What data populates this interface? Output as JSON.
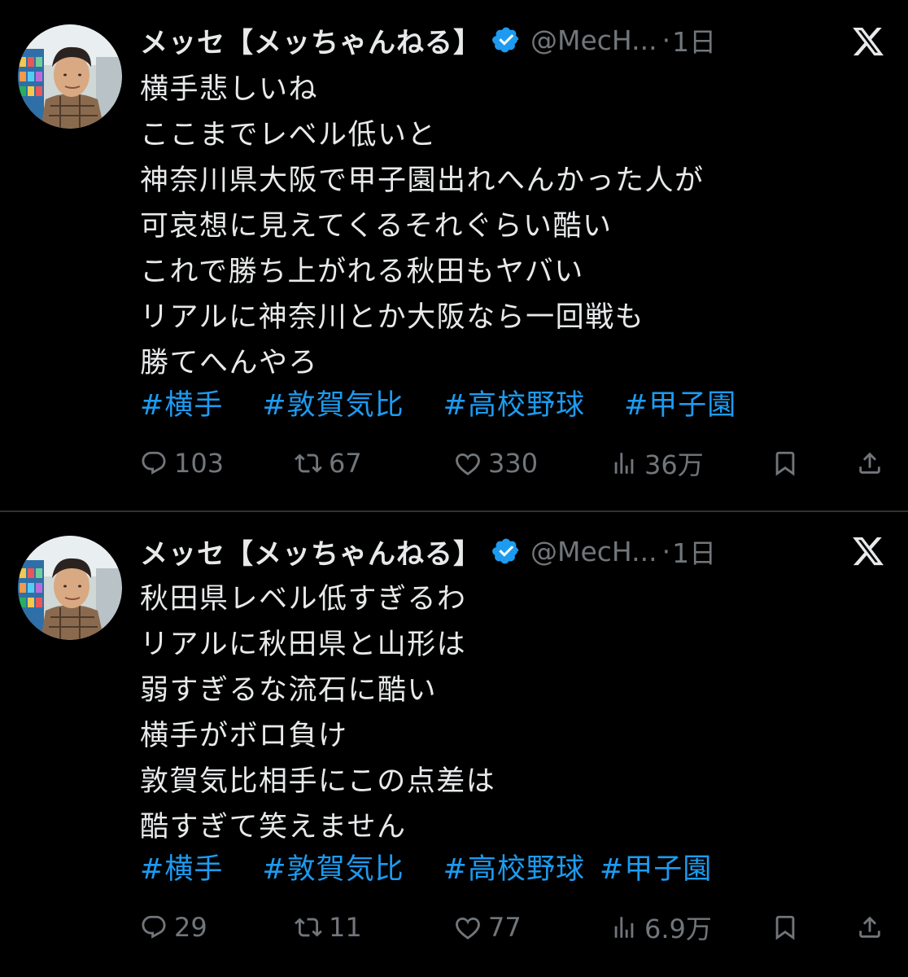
{
  "tweets": [
    {
      "display_name": "メッセ【メッちゃんねる】",
      "handle": "@MecH...",
      "separator": "·",
      "time": "1日",
      "lines": [
        "横手悲しいね",
        "ここまでレベル低いと",
        "神奈川県大阪で甲子園出れへんかった人が",
        "可哀想に見えてくるそれぐらい酷い",
        "これで勝ち上がれる秋田もヤバい",
        "リアルに神奈川とか大阪なら一回戦も",
        "勝てへんやろ"
      ],
      "hashtags": [
        "#横手",
        "#敦賀気比",
        "#高校野球",
        "#甲子園"
      ],
      "stats": {
        "replies": "103",
        "retweets": "67",
        "likes": "330",
        "views": "36万"
      }
    },
    {
      "display_name": "メッセ【メッちゃんねる】",
      "handle": "@MecH...",
      "separator": "·",
      "time": "1日",
      "lines": [
        "秋田県レベル低すぎるわ",
        "リアルに秋田県と山形は",
        "弱すぎるな流石に酷い",
        "横手がボロ負け",
        "敦賀気比相手にこの点差は",
        "酷すぎて笑えません"
      ],
      "hashtags": [
        "#横手",
        "#敦賀気比",
        "#高校野球",
        "#甲子園"
      ],
      "stats": {
        "replies": "29",
        "retweets": "11",
        "likes": "77",
        "views": "6.9万"
      }
    }
  ],
  "colors": {
    "background": "#000000",
    "text": "#e7e9ea",
    "muted": "#71767b",
    "accent": "#1d9bf0",
    "divider": "#2f3336"
  },
  "icons": {
    "reply": "speech-bubble-icon",
    "retweet": "retweet-arrows-icon",
    "like": "heart-icon",
    "views": "bar-chart-icon",
    "bookmark": "bookmark-icon",
    "share": "share-upload-icon",
    "brand": "x-logo-icon",
    "verified": "verified-badge-icon"
  }
}
